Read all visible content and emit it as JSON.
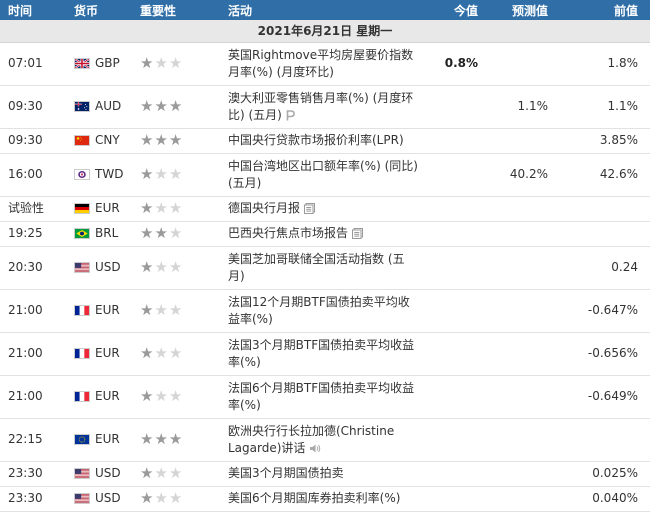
{
  "headers": {
    "time": "时间",
    "currency": "货币",
    "importance": "重要性",
    "event": "活动",
    "actual": "今值",
    "forecast": "预测值",
    "previous": "前值"
  },
  "date_label": "2021年6月21日  星期一",
  "rows": [
    {
      "time": "07:01",
      "currency": "GBP",
      "flag": "uk-flag",
      "stars": 1,
      "event": "英国Rightmove平均房屋要价指数月率(%) (月度环比)",
      "icon": "",
      "actual": "0.8%",
      "forecast": "",
      "previous": "1.8%"
    },
    {
      "time": "09:30",
      "currency": "AUD",
      "flag": "au-flag",
      "stars": 3,
      "event": "澳大利亚零售销售月率(%) (月度环比) (五月)",
      "icon": "preliminary-icon",
      "actual": "",
      "forecast": "1.1%",
      "previous": "1.1%"
    },
    {
      "time": "09:30",
      "currency": "CNY",
      "flag": "cn-flag",
      "stars": 3,
      "event": "中国央行贷款市场报价利率(LPR)",
      "icon": "",
      "actual": "",
      "forecast": "",
      "previous": "3.85%"
    },
    {
      "time": "16:00",
      "currency": "TWD",
      "flag": "tw-flag",
      "stars": 1,
      "event": "中国台湾地区出口额年率(%) (同比) (五月)",
      "icon": "",
      "actual": "",
      "forecast": "40.2%",
      "previous": "42.6%"
    },
    {
      "time": "试验性",
      "currency": "EUR",
      "flag": "de-flag",
      "stars": 1,
      "event": "德国央行月报",
      "icon": "document-icon",
      "actual": "",
      "forecast": "",
      "previous": ""
    },
    {
      "time": "19:25",
      "currency": "BRL",
      "flag": "br-flag",
      "stars": 2,
      "event": "巴西央行焦点市场报告",
      "icon": "document-icon",
      "actual": "",
      "forecast": "",
      "previous": ""
    },
    {
      "time": "20:30",
      "currency": "USD",
      "flag": "us-flag",
      "stars": 1,
      "event": "美国芝加哥联储全国活动指数 (五月)",
      "icon": "",
      "actual": "",
      "forecast": "",
      "previous": "0.24"
    },
    {
      "time": "21:00",
      "currency": "EUR",
      "flag": "fr-flag",
      "stars": 1,
      "event": "法国12个月期BTF国债拍卖平均收益率(%)",
      "icon": "",
      "actual": "",
      "forecast": "",
      "previous": "-0.647%"
    },
    {
      "time": "21:00",
      "currency": "EUR",
      "flag": "fr-flag",
      "stars": 1,
      "event": "法国3个月期BTF国债拍卖平均收益率(%)",
      "icon": "",
      "actual": "",
      "forecast": "",
      "previous": "-0.656%"
    },
    {
      "time": "21:00",
      "currency": "EUR",
      "flag": "fr-flag",
      "stars": 1,
      "event": "法国6个月期BTF国债拍卖平均收益率(%)",
      "icon": "",
      "actual": "",
      "forecast": "",
      "previous": "-0.649%"
    },
    {
      "time": "22:15",
      "currency": "EUR",
      "flag": "eu-flag",
      "stars": 3,
      "event": "欧洲央行行长拉加德(Christine Lagarde)讲话",
      "icon": "speaker-icon",
      "actual": "",
      "forecast": "",
      "previous": ""
    },
    {
      "time": "23:30",
      "currency": "USD",
      "flag": "us-flag",
      "stars": 1,
      "event": "美国3个月期国债拍卖",
      "icon": "",
      "actual": "",
      "forecast": "",
      "previous": "0.025%"
    },
    {
      "time": "23:30",
      "currency": "USD",
      "flag": "us-flag",
      "stars": 1,
      "event": "美国6个月期国库券拍卖利率(%)",
      "icon": "",
      "actual": "",
      "forecast": "",
      "previous": "0.040%"
    }
  ],
  "colors": {
    "header_bg": "#2f6ea6",
    "date_row_bg": "#e8e8e8",
    "star_on": "#9a9a9a",
    "star_off": "#d5d5d5"
  }
}
